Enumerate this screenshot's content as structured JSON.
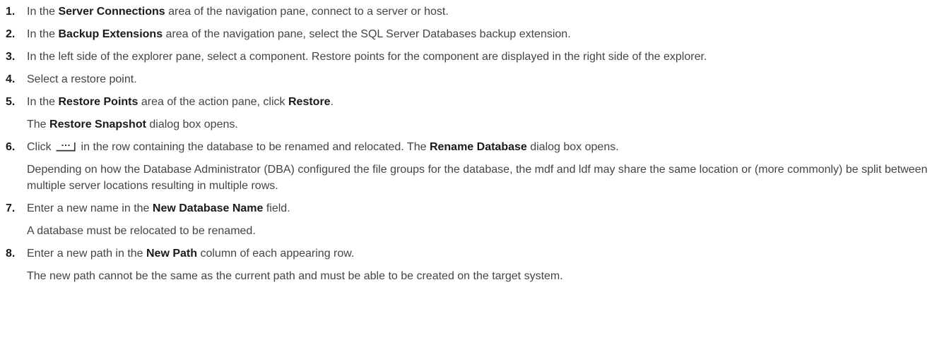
{
  "steps": [
    {
      "number": "1.",
      "segments": [
        "In the ",
        "Server Connections",
        " area of the navigation pane, connect to a server or host."
      ]
    },
    {
      "number": "2.",
      "segments": [
        "In the ",
        "Backup Extensions",
        " area of the navigation pane, select the SQL Server Databases backup extension."
      ]
    },
    {
      "number": "3.",
      "text": "In the left side of the explorer pane, select a component. Restore points for the component are displayed in the right side of the explorer."
    },
    {
      "number": "4.",
      "text": "Select a restore point."
    },
    {
      "number": "5.",
      "segments": [
        "In the ",
        "Restore Points",
        " area of the action pane, click ",
        "Restore",
        "."
      ],
      "note_segments": [
        "The ",
        "Restore Snapshot",
        " dialog box opens."
      ]
    },
    {
      "number": "6.",
      "segments": [
        "Click ",
        " in the row containing the database to be renamed and relocated. The ",
        "Rename Database",
        " dialog box opens."
      ],
      "icon": "ellipsis-button-icon",
      "note": "Depending on how the Database Administrator (DBA) configured the file groups for the database, the mdf and ldf may share the same location or (more commonly) be split between multiple server locations resulting in multiple rows."
    },
    {
      "number": "7.",
      "segments": [
        "Enter a new name in the ",
        "New Database Name",
        " field."
      ],
      "note": "A database must be relocated to be renamed."
    },
    {
      "number": "8.",
      "segments": [
        "Enter a new path in the ",
        "New Path",
        " column of each appearing row."
      ],
      "note": "The new path cannot be the same as the current path and must be able to be created on the target system."
    }
  ]
}
